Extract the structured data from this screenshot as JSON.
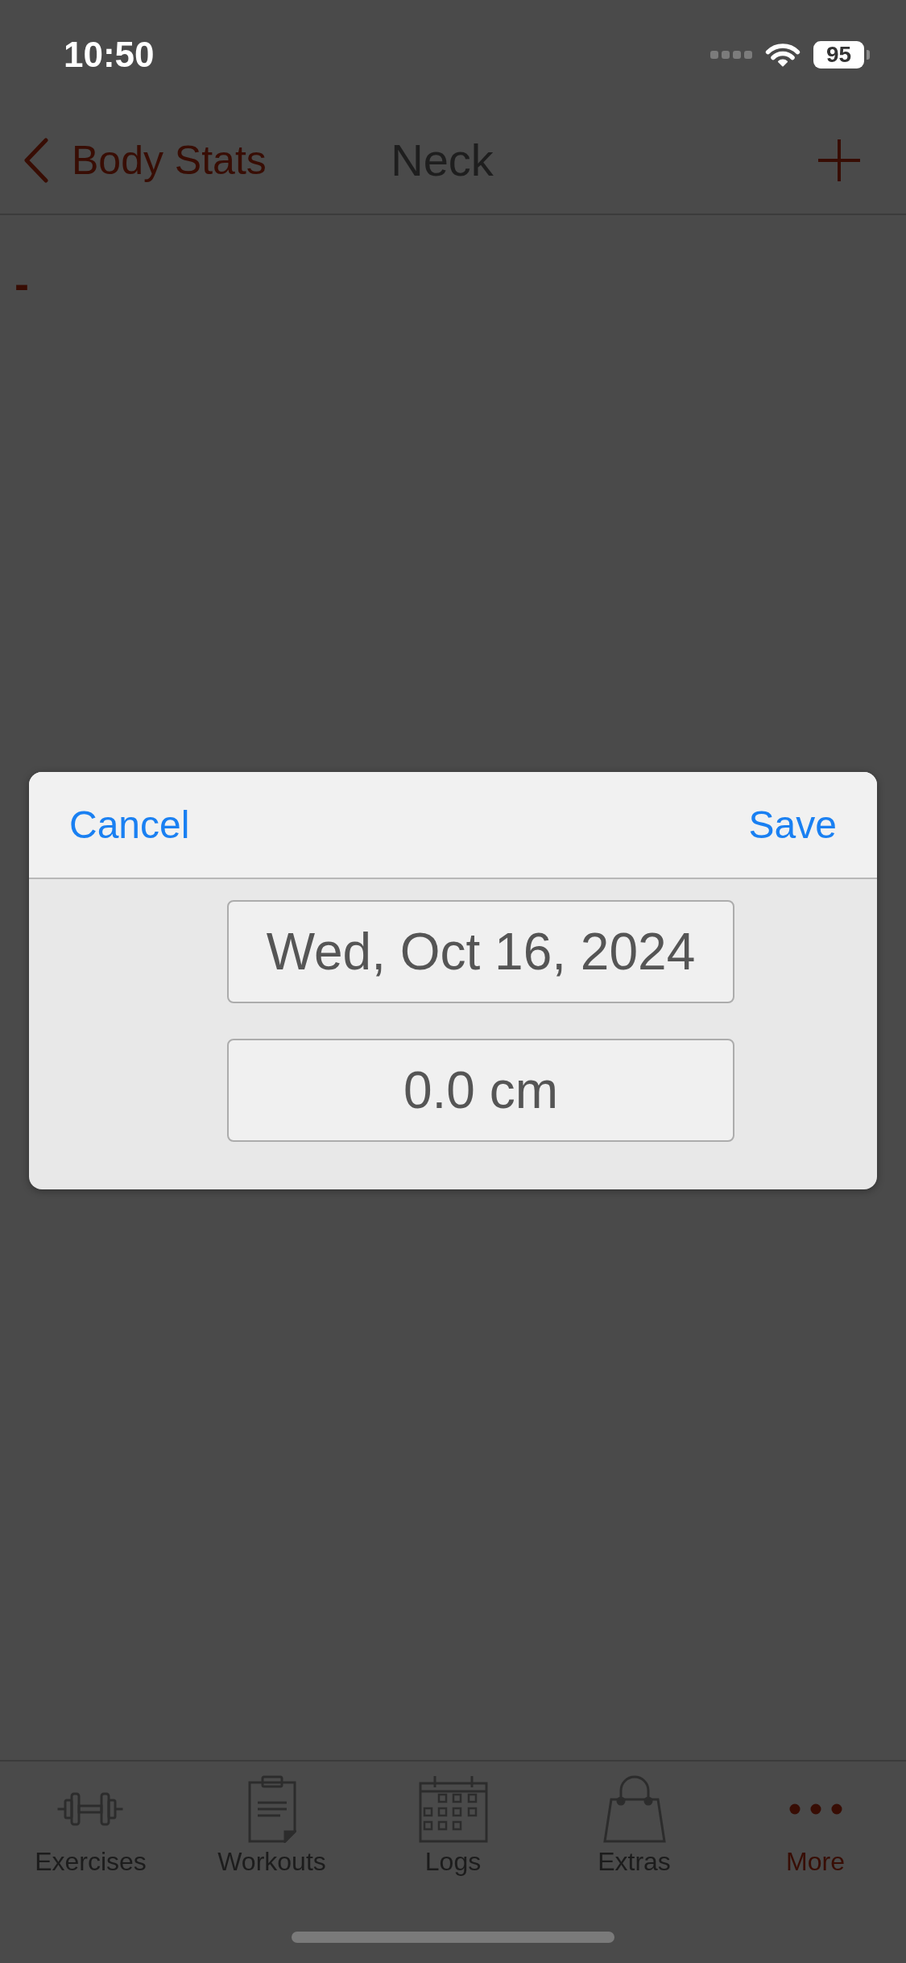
{
  "status_bar": {
    "time": "10:50",
    "battery": "95"
  },
  "nav_bar": {
    "back_label": "Body Stats",
    "title": "Neck"
  },
  "content": {
    "text": "-"
  },
  "dialog": {
    "cancel": "Cancel",
    "save": "Save",
    "fields": [
      {
        "value": "Wed, Oct 16, 2024"
      },
      {
        "value": "0.0 cm"
      }
    ]
  },
  "tab_bar": {
    "tabs": [
      {
        "kind": "dumbbell",
        "label": "Exercises",
        "selected": false
      },
      {
        "kind": "clipboard",
        "label": "Workouts",
        "selected": false
      },
      {
        "kind": "calendar",
        "label": "Logs",
        "selected": false
      },
      {
        "kind": "bag",
        "label": "Extras",
        "selected": false
      },
      {
        "kind": "dots",
        "label": "More",
        "selected": true
      }
    ]
  }
}
